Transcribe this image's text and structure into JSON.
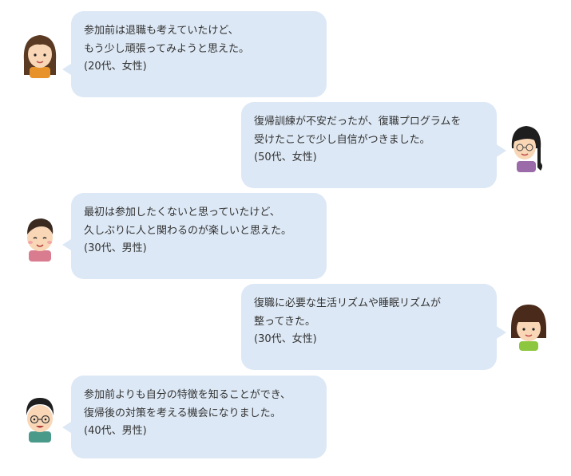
{
  "testimonials": [
    {
      "side": "left",
      "lines": [
        "参加前は退職も考えていたけど、",
        "もう少し頑張ってみようと思えた。"
      ],
      "meta": "(20代、女性)",
      "avatar": "woman-20s-avatar"
    },
    {
      "side": "right",
      "lines": [
        "復帰訓練が不安だったが、復職プログラムを",
        "受けたことで少し自信がつきました。"
      ],
      "meta": "(50代、女性)",
      "avatar": "woman-50s-avatar"
    },
    {
      "side": "left",
      "lines": [
        "最初は参加したくないと思っていたけど、",
        "久しぶりに人と関わるのが楽しいと思えた。"
      ],
      "meta": "(30代、男性)",
      "avatar": "man-30s-avatar"
    },
    {
      "side": "right",
      "lines": [
        "復職に必要な生活リズムや睡眠リズムが",
        "整ってきた。"
      ],
      "meta": "(30代、女性)",
      "avatar": "woman-30s-avatar"
    },
    {
      "side": "left",
      "lines": [
        "参加前よりも自分の特徴を知ることができ、",
        "復帰後の対策を考える機会になりました。"
      ],
      "meta": "(40代、男性)",
      "avatar": "man-40s-avatar"
    }
  ],
  "colors": {
    "bubble": "#dce8f5",
    "text": "#333333"
  }
}
